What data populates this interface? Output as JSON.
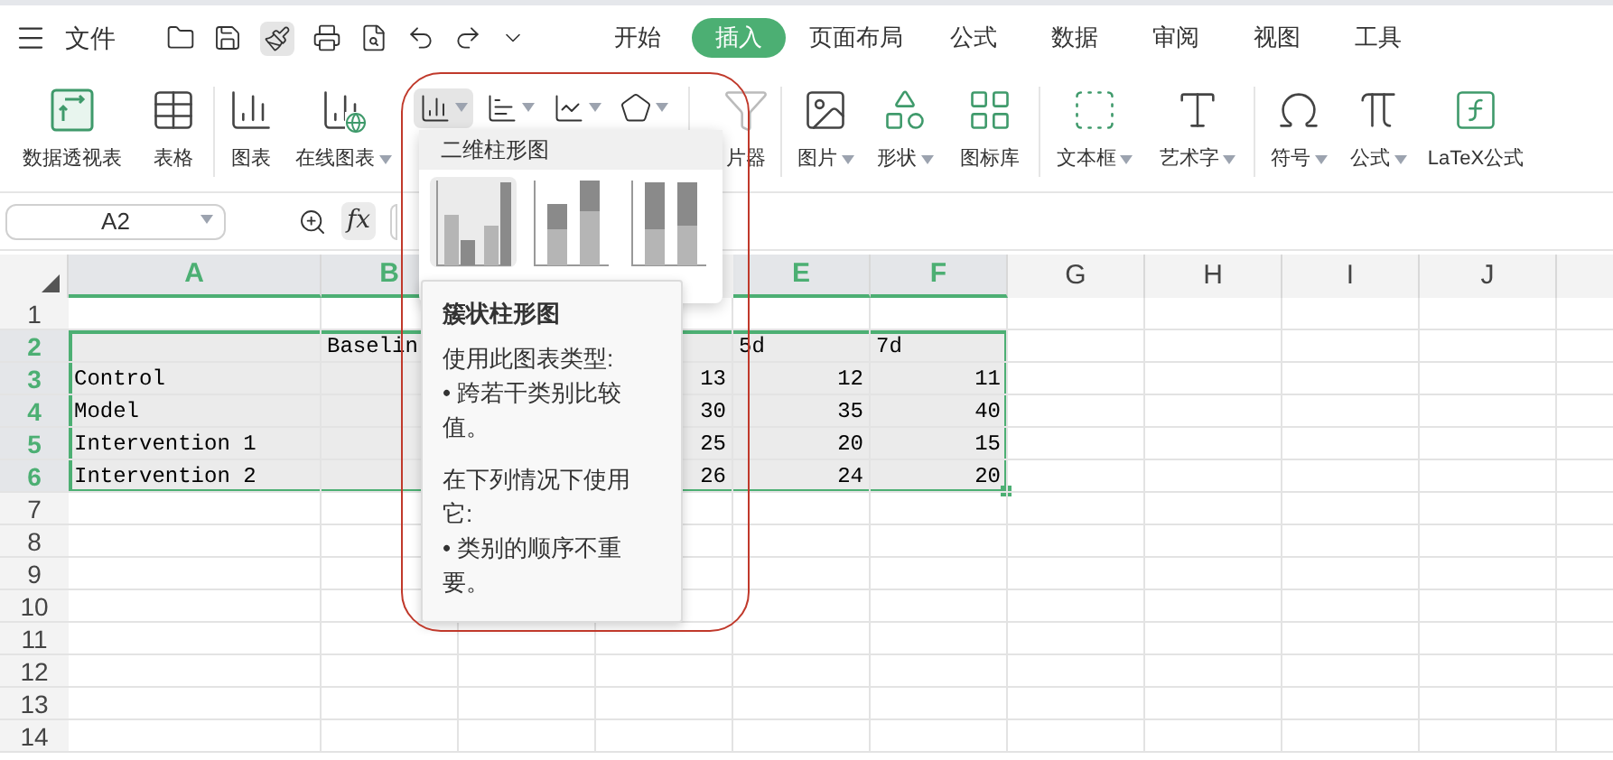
{
  "menu_bar": {
    "file_label": "文件",
    "tabs": [
      {
        "label": "开始",
        "selected": false
      },
      {
        "label": "插入",
        "selected": true
      },
      {
        "label": "页面布局",
        "selected": false
      },
      {
        "label": "公式",
        "selected": false
      },
      {
        "label": "数据",
        "selected": false
      },
      {
        "label": "审阅",
        "selected": false
      },
      {
        "label": "视图",
        "selected": false
      },
      {
        "label": "工具",
        "selected": false
      }
    ]
  },
  "ribbon": {
    "groups": [
      [
        {
          "kind": "pivot",
          "label": "数据透视表",
          "dropdown": false
        },
        {
          "kind": "table",
          "label": "表格",
          "dropdown": false
        }
      ],
      [
        {
          "kind": "chart",
          "label": "图表",
          "dropdown": false
        },
        {
          "kind": "online-chart",
          "label": "在线图表",
          "dropdown": true
        }
      ],
      [
        {
          "kind": "slicer",
          "label": "片器",
          "dropdown": false
        }
      ],
      [
        {
          "kind": "picture",
          "label": "图片",
          "dropdown": true
        },
        {
          "kind": "shape",
          "label": "形状",
          "dropdown": true
        },
        {
          "kind": "icon-library",
          "label": "图标库",
          "dropdown": false
        }
      ],
      [
        {
          "kind": "textbox",
          "label": "文本框",
          "dropdown": true
        },
        {
          "kind": "wordart",
          "label": "艺术字",
          "dropdown": true
        }
      ],
      [
        {
          "kind": "symbol",
          "label": "符号",
          "dropdown": true
        },
        {
          "kind": "formula",
          "label": "公式",
          "dropdown": true
        },
        {
          "kind": "latex",
          "label": "LaTeX公式",
          "dropdown": false
        }
      ]
    ],
    "chart_types": [
      {
        "kind": "column",
        "selected": true
      },
      {
        "kind": "bar",
        "selected": false
      },
      {
        "kind": "line",
        "selected": false
      },
      {
        "kind": "radar",
        "selected": false
      }
    ]
  },
  "formula_bar": {
    "name_box": "A2",
    "fx": "fx"
  },
  "sheet": {
    "columns": [
      {
        "label": "A",
        "selected": true
      },
      {
        "label": "B",
        "selected": true
      },
      {},
      {},
      {
        "label": "E",
        "selected": true
      },
      {
        "label": "F",
        "selected": true
      },
      {
        "label": "G",
        "selected": false
      },
      {
        "label": "H",
        "selected": false
      },
      {
        "label": "I",
        "selected": false
      },
      {
        "label": "J",
        "selected": false
      }
    ],
    "rows": [
      {
        "label": "1",
        "selected": false,
        "kind": "empty",
        "cells": []
      },
      {
        "label": "2",
        "selected": true,
        "kind": "header",
        "cells": [
          "",
          "Baselin",
          "",
          "",
          "5d",
          "7d"
        ]
      },
      {
        "label": "3",
        "selected": true,
        "kind": "data",
        "cells": [
          "Control",
          "",
          "",
          "13",
          "12",
          "11"
        ]
      },
      {
        "label": "4",
        "selected": true,
        "kind": "data",
        "cells": [
          "Model",
          "",
          "",
          "30",
          "35",
          "40"
        ]
      },
      {
        "label": "5",
        "selected": true,
        "kind": "data",
        "cells": [
          "Intervention 1",
          "",
          "",
          "25",
          "20",
          "15"
        ]
      },
      {
        "label": "6",
        "selected": true,
        "kind": "data",
        "cells": [
          "Intervention 2",
          "",
          "",
          "26",
          "24",
          "20"
        ]
      },
      {
        "label": "7",
        "selected": false,
        "kind": "empty",
        "cells": []
      },
      {
        "label": "8",
        "selected": false,
        "kind": "empty",
        "cells": []
      },
      {
        "label": "9",
        "selected": false,
        "kind": "empty",
        "cells": []
      },
      {
        "label": "10",
        "selected": false,
        "kind": "empty",
        "cells": []
      },
      {
        "label": "11",
        "selected": false,
        "kind": "empty",
        "cells": []
      },
      {
        "label": "12",
        "selected": false,
        "kind": "empty",
        "cells": []
      },
      {
        "label": "13",
        "selected": false,
        "kind": "empty",
        "cells": []
      },
      {
        "label": "14",
        "selected": false,
        "kind": "empty",
        "cells": []
      }
    ]
  },
  "chart_dropdown": {
    "title": "二维柱形图",
    "options": [
      {
        "kind": "clustered",
        "selected": true
      },
      {
        "kind": "stacked",
        "selected": false
      },
      {
        "kind": "percent",
        "selected": false
      }
    ]
  },
  "tooltip": {
    "title": "簇状柱形图",
    "lines": [
      "使用此图表类型:",
      "• 跨若干类别比较值。",
      "在下列情况下使用它:",
      "• 类别的顺序不重要。"
    ]
  }
}
